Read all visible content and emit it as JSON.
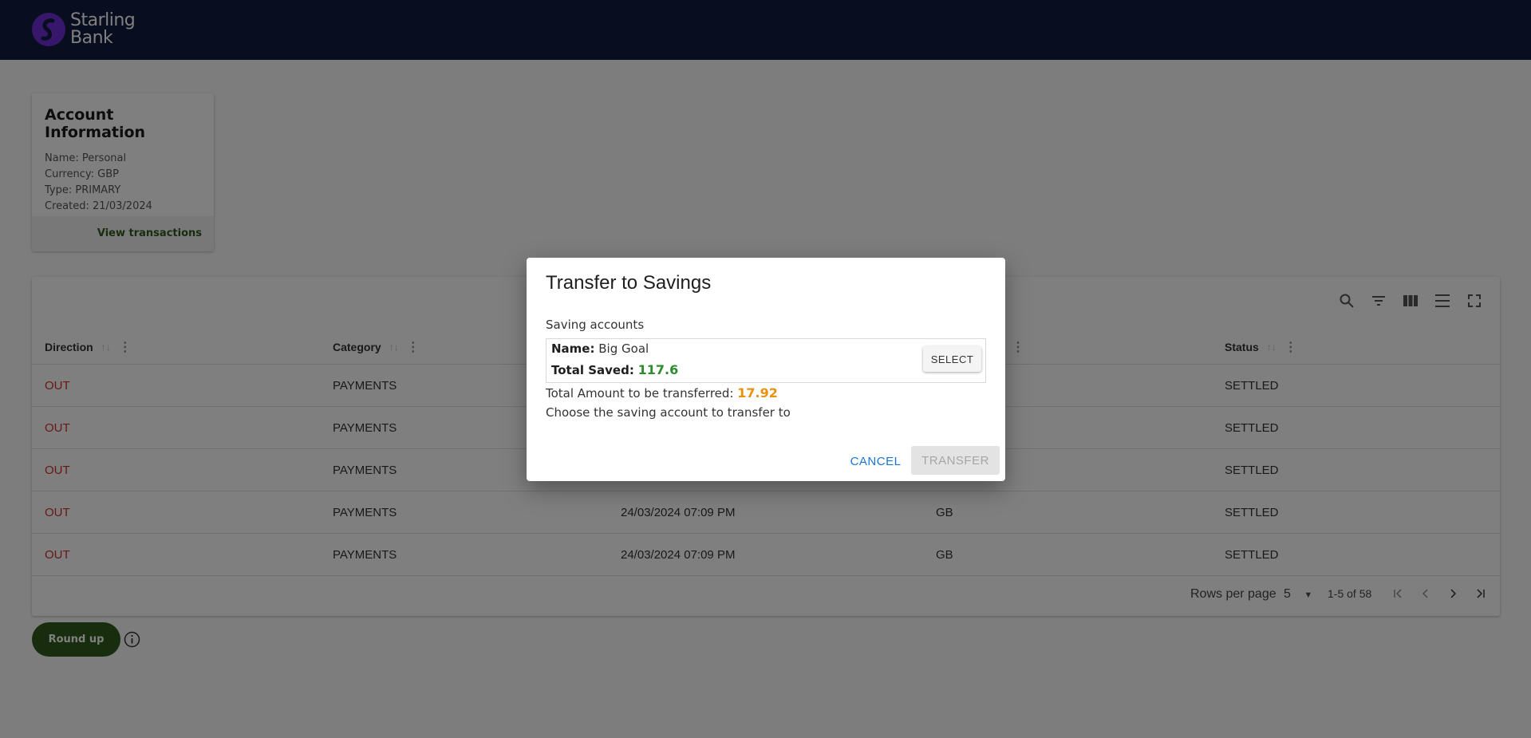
{
  "brand": {
    "name_line1": "Starling",
    "name_line2": "Bank",
    "logo_color": "#6d2fd6",
    "header_color": "#101b3e"
  },
  "account_card": {
    "title": "Account Information",
    "lines": [
      "Name: Personal",
      "Currency: GBP",
      "Type: PRIMARY",
      "Created: 21/03/2024"
    ],
    "view_transactions": "View transactions"
  },
  "toolbar": {
    "icons": [
      "search-icon",
      "filter-icon",
      "columns-icon",
      "density-icon",
      "fullscreen-icon"
    ]
  },
  "table": {
    "columns": [
      "Direction",
      "Category",
      "",
      "",
      "Status"
    ],
    "rows": [
      [
        "OUT",
        "PAYMENTS",
        "",
        "",
        "SETTLED"
      ],
      [
        "OUT",
        "PAYMENTS",
        "",
        "",
        "SETTLED"
      ],
      [
        "OUT",
        "PAYMENTS",
        "",
        "",
        "SETTLED"
      ],
      [
        "OUT",
        "PAYMENTS",
        "24/03/2024 07:09 PM",
        "GB",
        "SETTLED"
      ],
      [
        "OUT",
        "PAYMENTS",
        "24/03/2024 07:09 PM",
        "GB",
        "SETTLED"
      ]
    ],
    "out_color": "#d32f2f"
  },
  "pagination": {
    "rows_per_page_label": "Rows per page",
    "rows_per_page": "5",
    "range": "1-5 of 58"
  },
  "round_up_button": "Round up",
  "dialog": {
    "title": "Transfer to Savings",
    "saving_accounts_label": "Saving accounts",
    "account": {
      "name_label": "Name:",
      "name": "Big Goal",
      "total_label": "Total Saved:",
      "total": "117.6"
    },
    "select_label": "SELECT",
    "amount_label": "Total Amount to be transferred:",
    "amount": "17.92",
    "instruction": "Choose the saving account to transfer to",
    "cancel_label": "CANCEL",
    "transfer_label": "TRANSFER",
    "transfer_enabled": false
  }
}
